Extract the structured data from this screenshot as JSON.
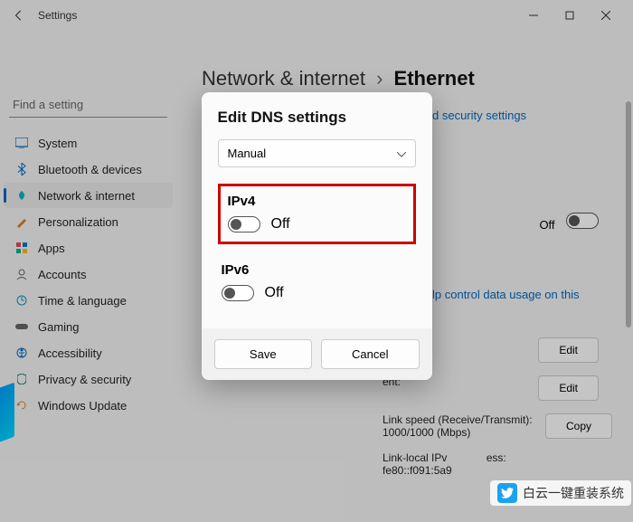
{
  "titlebar": {
    "title": "Settings"
  },
  "search": {
    "placeholder": "Find a setting"
  },
  "nav": {
    "items": [
      {
        "label": "System"
      },
      {
        "label": "Bluetooth & devices"
      },
      {
        "label": "Network & internet"
      },
      {
        "label": "Personalization"
      },
      {
        "label": "Apps"
      },
      {
        "label": "Accounts"
      },
      {
        "label": "Time & language"
      },
      {
        "label": "Gaming"
      },
      {
        "label": "Accessibility"
      },
      {
        "label": "Privacy & security"
      },
      {
        "label": "Windows Update"
      }
    ]
  },
  "breadcrumb": {
    "parent": "Network & internet",
    "current": "Ethernet"
  },
  "content": {
    "security_link": "d security settings",
    "off_label": "Off",
    "data_usage_link": "lp control data usage on this",
    "edit_button": "Edit",
    "assignment_label_suffix": "ent:",
    "link_speed_label": "Link speed (Receive/Transmit):",
    "link_speed_value": "1000/1000 (Mbps)",
    "copy_button": "Copy",
    "link_local_label": "Link-local IPv",
    "link_local_suffix": "ess:",
    "link_local_value_frag": "fe80::f091:5a9"
  },
  "modal": {
    "title": "Edit DNS settings",
    "mode": "Manual",
    "ipv4": {
      "title": "IPv4",
      "status": "Off"
    },
    "ipv6": {
      "title": "IPv6",
      "status": "Off"
    },
    "save": "Save",
    "cancel": "Cancel"
  },
  "watermark": {
    "text": "白云一键重装系统"
  }
}
